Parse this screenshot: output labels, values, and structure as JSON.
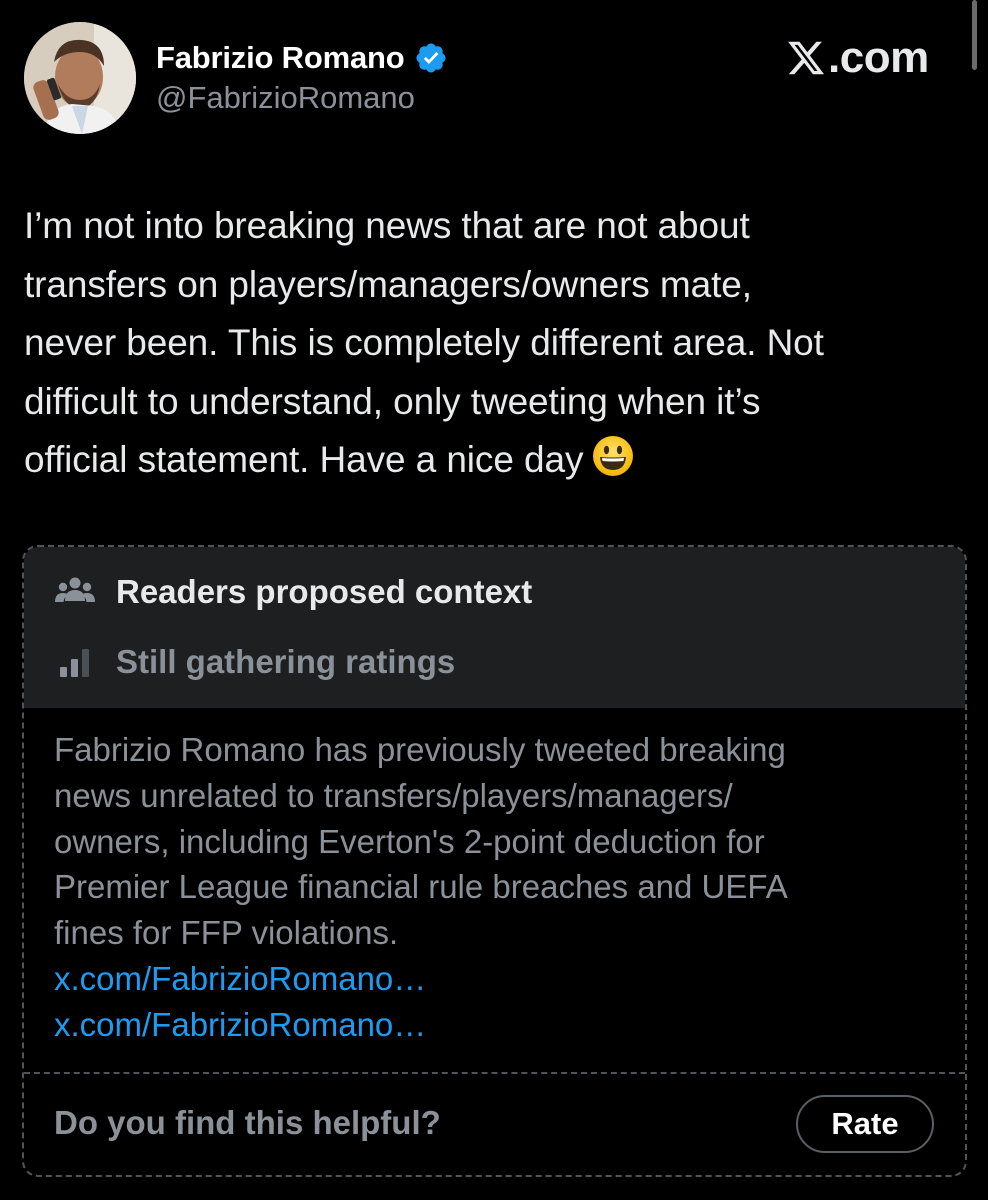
{
  "header": {
    "display_name": "Fabrizio Romano",
    "handle": "@FabrizioRomano",
    "brand": ".com",
    "verified_color": "#1d9bf0",
    "avatar_icon": "profile-photo",
    "verified_icon": "verified-badge-icon",
    "brand_icon": "x-logo-icon"
  },
  "tweet": {
    "lines": [
      "I’m not into breaking news that are not about",
      "transfers on players/managers/owners mate,",
      "never been. This is completely different area. Not",
      "difficult to understand, only tweeting when it’s",
      "official statement. Have a nice day"
    ],
    "emoji": "grinning-face-emoji"
  },
  "note": {
    "title": "Readers proposed context",
    "status": "Still gathering ratings",
    "body_lines": [
      "Fabrizio Romano has previously tweeted breaking",
      "news unrelated to transfers/players/managers/",
      "owners, including Everton's 2-point deduction for",
      "Premier League financial rule breaches and UEFA",
      "fines for FFP violations."
    ],
    "links": [
      "x.com/FabrizioRomano…",
      "x.com/FabrizioRomano…"
    ],
    "helpful_question": "Do you find this helpful?",
    "rate_label": "Rate",
    "link_color": "#1d9bf0",
    "title_icon": "people-group-icon",
    "status_icon": "bar-chart-icon"
  }
}
